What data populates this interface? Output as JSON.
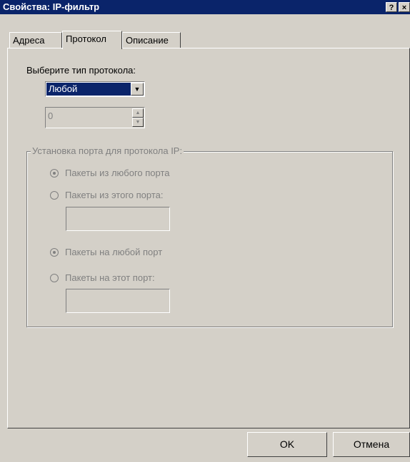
{
  "window": {
    "title": "Свойства: IP-фильтр",
    "help_label": "?",
    "close_label": "×"
  },
  "tabs": [
    {
      "label": "Адреса",
      "active": false
    },
    {
      "label": "Протокол",
      "active": true
    },
    {
      "label": "Описание",
      "active": false
    }
  ],
  "protocol": {
    "select_label": "Выберите тип протокола:",
    "selected": "Любой",
    "number_value": "0"
  },
  "port_group": {
    "caption": "Установка порта для протокола IP:",
    "from_any": "Пакеты из любого порта",
    "from_this": "Пакеты из этого порта:",
    "to_any": "Пакеты на любой порт",
    "to_this": "Пакеты на этот порт:"
  },
  "buttons": {
    "ok": "OK",
    "cancel": "Отмена"
  }
}
